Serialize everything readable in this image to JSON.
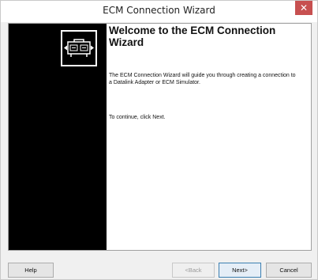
{
  "window": {
    "title": "ECM Connection Wizard",
    "close_glyph": "✕"
  },
  "wizard": {
    "heading": "Welcome to the ECM Connection Wizard",
    "description": "The ECM Connection Wizard will guide you through creating a connection to a Datalink Adapter or ECM Simulator.",
    "instruction": "To continue, click Next.",
    "logo_icon": "ecm-module-icon"
  },
  "buttons": {
    "help": "Help",
    "back": "<Back",
    "next": "Next>",
    "cancel": "Cancel"
  },
  "colors": {
    "close_button": "#c75050",
    "side_panel": "#000000",
    "default_button_border": "#3c7fb1"
  }
}
